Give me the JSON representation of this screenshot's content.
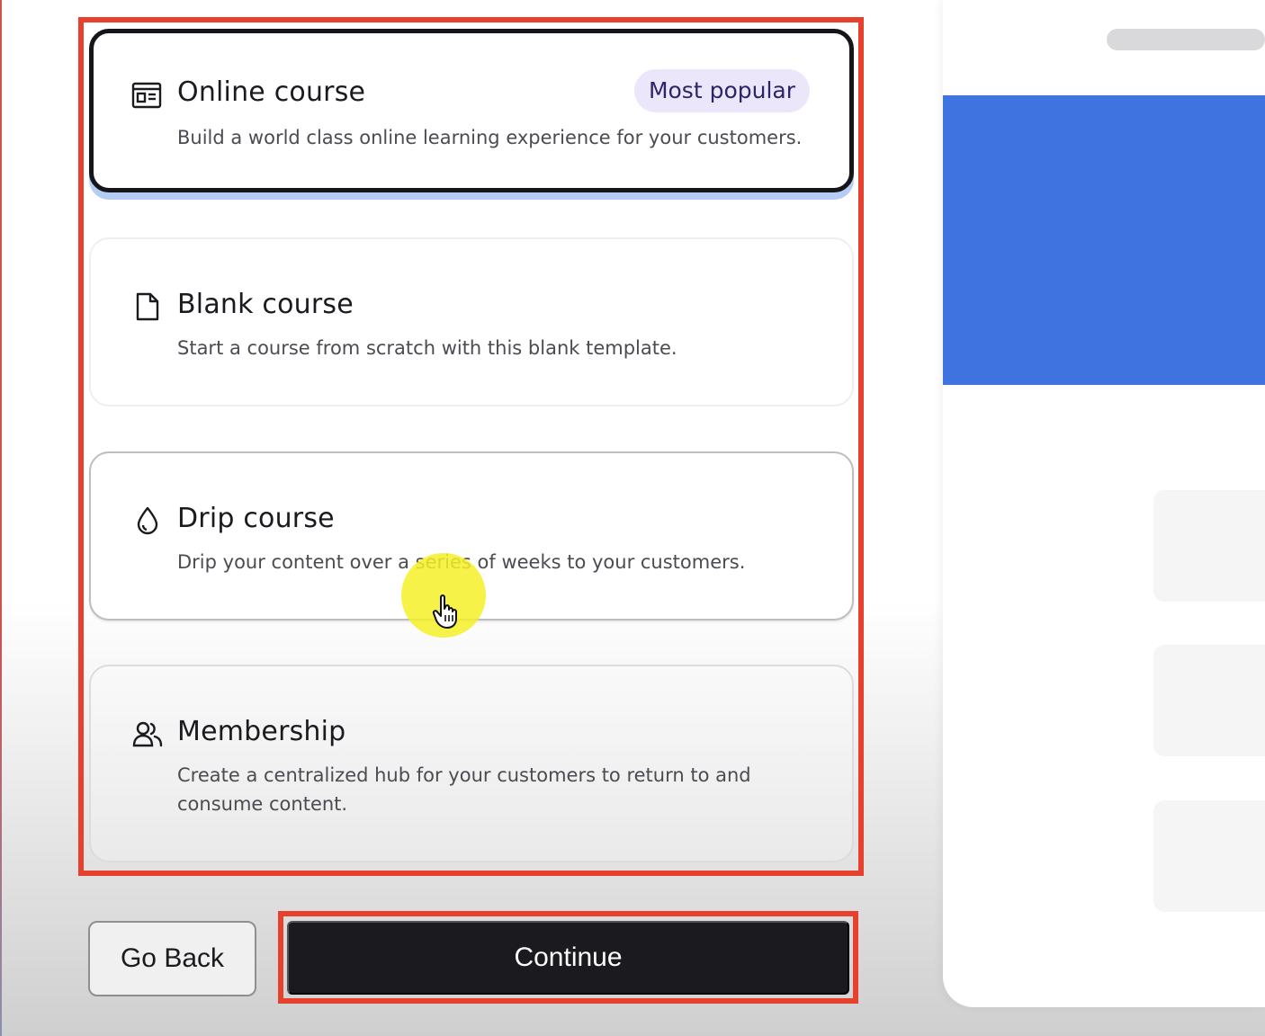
{
  "options": [
    {
      "title": "Online course",
      "description": "Build a world class online learning experience for your customers.",
      "badge": "Most popular",
      "icon": "layout-icon"
    },
    {
      "title": "Blank course",
      "description": "Start a course from scratch with this blank template.",
      "icon": "blank-page-icon"
    },
    {
      "title": "Drip course",
      "description": "Drip your content over a series of weeks to your customers.",
      "icon": "droplet-icon"
    },
    {
      "title": "Membership",
      "description": "Create a centralized hub for your customers to return to and consume content.",
      "icon": "users-icon"
    }
  ],
  "actions": {
    "back_label": "Go Back",
    "continue_label": "Continue"
  },
  "colors": {
    "highlight": "#e5412d",
    "primary_button": "#1a1a1f",
    "badge_bg": "#ece6fa",
    "badge_text": "#2c2566",
    "preview_hero": "#3f74e0",
    "selected_shadow": "#b5cdf5"
  }
}
